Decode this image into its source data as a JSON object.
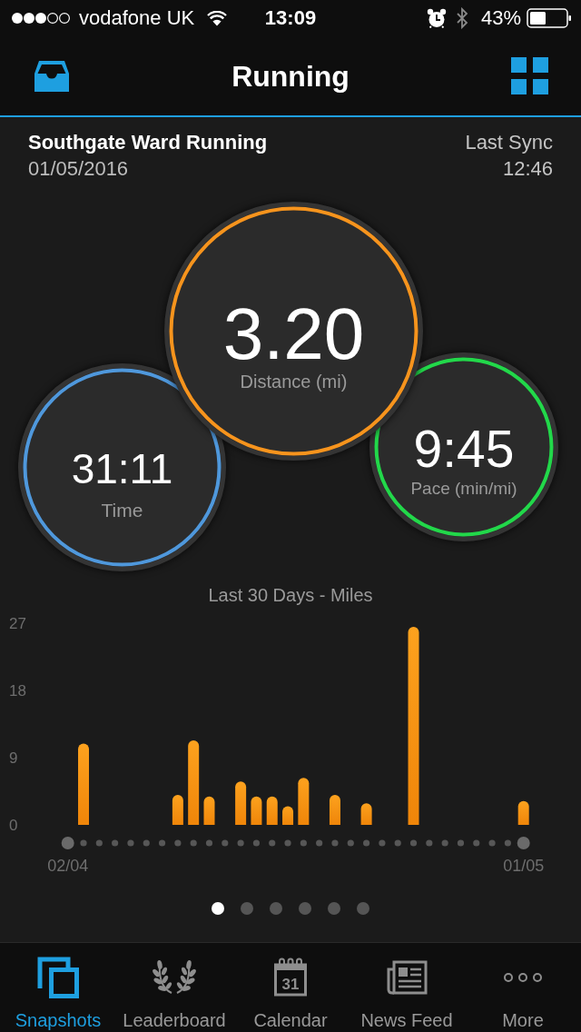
{
  "status_bar": {
    "carrier": "vodafone UK",
    "time": "13:09",
    "battery": "43%"
  },
  "nav_bar": {
    "title": "Running"
  },
  "activity": {
    "title": "Southgate Ward Running",
    "date": "01/05/2016",
    "sync_label": "Last Sync",
    "sync_time": "12:46"
  },
  "metrics": [
    {
      "value": "3.20",
      "label": "Distance (mi)",
      "color": "#f7941d"
    },
    {
      "value": "31:11",
      "label": "Time",
      "color": "#4f98dc"
    },
    {
      "value": "9:45",
      "label": "Pace (min/mi)",
      "color": "#22d84a"
    }
  ],
  "chart": {
    "chart_data": {
      "type": "bar",
      "title": "Last 30 Days - Miles",
      "categories": [
        "02/04",
        null,
        null,
        null,
        null,
        null,
        null,
        null,
        null,
        null,
        null,
        null,
        null,
        null,
        null,
        null,
        null,
        null,
        null,
        null,
        null,
        null,
        null,
        null,
        null,
        null,
        null,
        null,
        null,
        "01/05"
      ],
      "values": [
        0,
        10.9,
        0,
        0,
        0,
        0,
        0,
        4.0,
        11.3,
        3.8,
        0,
        5.8,
        3.8,
        3.8,
        2.5,
        6.3,
        0,
        4.0,
        0,
        2.9,
        0,
        0,
        26.5,
        0,
        0,
        0,
        0,
        0,
        0,
        3.2
      ],
      "ylim": [
        0,
        27
      ],
      "yticks": [
        0,
        9,
        18,
        27
      ]
    }
  },
  "page_indicator": [
    {
      "selected": true
    },
    {
      "selected": false
    },
    {
      "selected": false
    },
    {
      "selected": false
    },
    {
      "selected": false
    },
    {
      "selected": false
    }
  ],
  "tab_bar": [
    {
      "kind": "snapshots",
      "label": "Snapshots",
      "selected": true
    },
    {
      "kind": "leaderboard",
      "label": "Leaderboard",
      "selected": false
    },
    {
      "kind": "calendar",
      "label": "Calendar",
      "icon_text": "31",
      "selected": false
    },
    {
      "kind": "news",
      "label": "News Feed",
      "selected": false
    },
    {
      "kind": "more",
      "label": "More",
      "selected": false
    }
  ]
}
